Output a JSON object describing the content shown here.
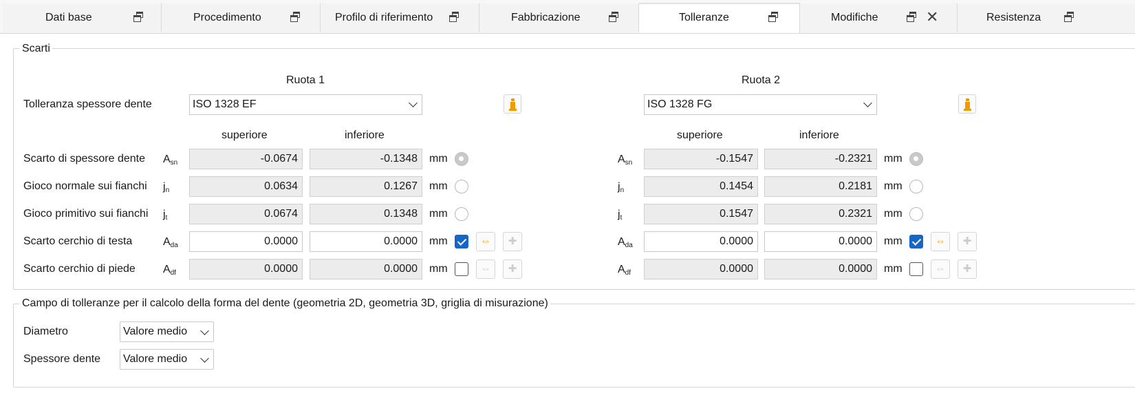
{
  "tabs": [
    {
      "label": "Dati base"
    },
    {
      "label": "Procedimento"
    },
    {
      "label": "Profilo di riferimento"
    },
    {
      "label": "Fabbricazione"
    },
    {
      "label": "Tolleranze"
    },
    {
      "label": "Modifiche"
    },
    {
      "label": "Resistenza"
    }
  ],
  "scarti": {
    "title": "Scarti",
    "wheel1": "Ruota 1",
    "wheel2": "Ruota 2",
    "thickness_tol_label": "Tolleranza spessore dente",
    "wheel1_tol": "ISO 1328 EF",
    "wheel2_tol": "ISO 1328 FG",
    "col_upper": "superiore",
    "col_lower": "inferiore",
    "unit": "mm",
    "rows": [
      {
        "label": "Scarto di spessore dente",
        "sym": "A",
        "sub": "sn",
        "w1u": "-0.0674",
        "w1l": "-0.1348",
        "w2u": "-0.1547",
        "w2l": "-0.2321"
      },
      {
        "label": "Gioco normale sui fianchi",
        "sym": "j",
        "sub": "n",
        "w1u": "0.0634",
        "w1l": "0.1267",
        "w2u": "0.1454",
        "w2l": "0.2181"
      },
      {
        "label": "Gioco primitivo sui fianchi",
        "sym": "j",
        "sub": "t",
        "w1u": "0.0674",
        "w1l": "0.1348",
        "w2u": "0.1547",
        "w2l": "0.2321"
      },
      {
        "label": "Scarto cerchio di testa",
        "sym": "A",
        "sub": "da",
        "w1u": "0.0000",
        "w1l": "0.0000",
        "w2u": "0.0000",
        "w2l": "0.0000"
      },
      {
        "label": "Scarto cerchio di piede",
        "sym": "A",
        "sub": "df",
        "w1u": "0.0000",
        "w1l": "0.0000",
        "w2u": "0.0000",
        "w2l": "0.0000"
      }
    ]
  },
  "campo": {
    "title": "Campo di tolleranze per il calcolo della forma del dente (geometria 2D, geometria 3D, griglia di misurazione)",
    "diametro_label": "Diametro",
    "diametro_value": "Valore medio",
    "spessore_label": "Spessore dente",
    "spessore_value": "Valore medio"
  },
  "colors": {
    "accent": "#1666c5",
    "orange": "#f0a000"
  },
  "icons": [
    "restore-window-icon",
    "close-icon",
    "chevron-down-icon",
    "info-icon",
    "swap-arrows-icon",
    "plus-icon",
    "check-icon"
  ]
}
